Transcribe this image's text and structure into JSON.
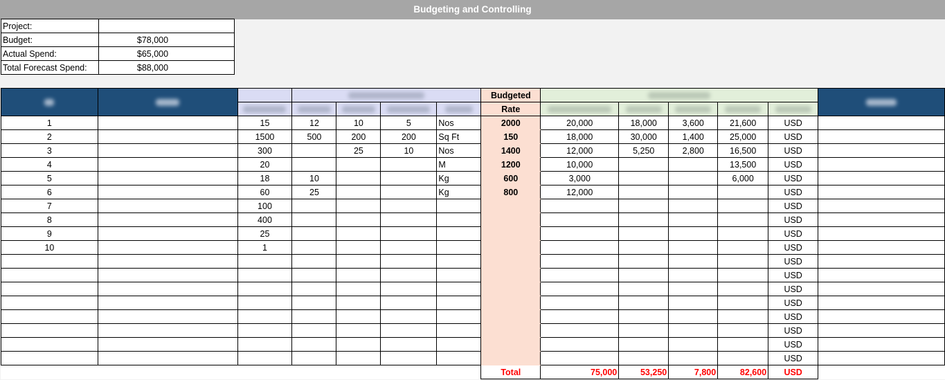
{
  "title": "Budgeting and Controlling",
  "summary": [
    {
      "label": "Project:",
      "value": ""
    },
    {
      "label": "Budget:",
      "value": "$78,000"
    },
    {
      "label": "Actual Spend:",
      "value": "$65,000"
    },
    {
      "label": "Total Forecast Spend:",
      "value": "$88,000"
    }
  ],
  "header": {
    "rate_line1": "Budgeted",
    "rate_line2": "Rate"
  },
  "rows": [
    {
      "n": "1",
      "q1": "15",
      "q2": "12",
      "q3": "10",
      "q4": "5",
      "unit": "Nos",
      "rate": "2000",
      "c1": "20,000",
      "c2": "18,000",
      "c3": "3,600",
      "c4": "21,600",
      "cur": "USD"
    },
    {
      "n": "2",
      "q1": "1500",
      "q2": "500",
      "q3": "200",
      "q4": "200",
      "unit": "Sq Ft",
      "rate": "150",
      "c1": "18,000",
      "c2": "30,000",
      "c3": "1,400",
      "c4": "25,000",
      "cur": "USD"
    },
    {
      "n": "3",
      "q1": "300",
      "q2": "",
      "q3": "25",
      "q4": "10",
      "unit": "Nos",
      "rate": "1400",
      "c1": "12,000",
      "c2": "5,250",
      "c3": "2,800",
      "c4": "16,500",
      "cur": "USD"
    },
    {
      "n": "4",
      "q1": "20",
      "q2": "",
      "q3": "",
      "q4": "",
      "unit": "M",
      "rate": "1200",
      "c1": "10,000",
      "c2": "",
      "c3": "",
      "c4": "13,500",
      "cur": "USD"
    },
    {
      "n": "5",
      "q1": "18",
      "q2": "10",
      "q3": "",
      "q4": "",
      "unit": "Kg",
      "rate": "600",
      "c1": "3,000",
      "c2": "",
      "c3": "",
      "c4": "6,000",
      "cur": "USD"
    },
    {
      "n": "6",
      "q1": "60",
      "q2": "25",
      "q3": "",
      "q4": "",
      "unit": "Kg",
      "rate": "800",
      "c1": "12,000",
      "c2": "",
      "c3": "",
      "c4": "",
      "cur": "USD"
    },
    {
      "n": "7",
      "q1": "100",
      "q2": "",
      "q3": "",
      "q4": "",
      "unit": "",
      "rate": "",
      "c1": "",
      "c2": "",
      "c3": "",
      "c4": "",
      "cur": "USD"
    },
    {
      "n": "8",
      "q1": "400",
      "q2": "",
      "q3": "",
      "q4": "",
      "unit": "",
      "rate": "",
      "c1": "",
      "c2": "",
      "c3": "",
      "c4": "",
      "cur": "USD"
    },
    {
      "n": "9",
      "q1": "25",
      "q2": "",
      "q3": "",
      "q4": "",
      "unit": "",
      "rate": "",
      "c1": "",
      "c2": "",
      "c3": "",
      "c4": "",
      "cur": "USD"
    },
    {
      "n": "10",
      "q1": "1",
      "q2": "",
      "q3": "",
      "q4": "",
      "unit": "",
      "rate": "",
      "c1": "",
      "c2": "",
      "c3": "",
      "c4": "",
      "cur": "USD"
    },
    {
      "n": "",
      "q1": "",
      "q2": "",
      "q3": "",
      "q4": "",
      "unit": "",
      "rate": "",
      "c1": "",
      "c2": "",
      "c3": "",
      "c4": "",
      "cur": "USD"
    },
    {
      "n": "",
      "q1": "",
      "q2": "",
      "q3": "",
      "q4": "",
      "unit": "",
      "rate": "",
      "c1": "",
      "c2": "",
      "c3": "",
      "c4": "",
      "cur": "USD"
    },
    {
      "n": "",
      "q1": "",
      "q2": "",
      "q3": "",
      "q4": "",
      "unit": "",
      "rate": "",
      "c1": "",
      "c2": "",
      "c3": "",
      "c4": "",
      "cur": "USD"
    },
    {
      "n": "",
      "q1": "",
      "q2": "",
      "q3": "",
      "q4": "",
      "unit": "",
      "rate": "",
      "c1": "",
      "c2": "",
      "c3": "",
      "c4": "",
      "cur": "USD"
    },
    {
      "n": "",
      "q1": "",
      "q2": "",
      "q3": "",
      "q4": "",
      "unit": "",
      "rate": "",
      "c1": "",
      "c2": "",
      "c3": "",
      "c4": "",
      "cur": "USD"
    },
    {
      "n": "",
      "q1": "",
      "q2": "",
      "q3": "",
      "q4": "",
      "unit": "",
      "rate": "",
      "c1": "",
      "c2": "",
      "c3": "",
      "c4": "",
      "cur": "USD"
    },
    {
      "n": "",
      "q1": "",
      "q2": "",
      "q3": "",
      "q4": "",
      "unit": "",
      "rate": "",
      "c1": "",
      "c2": "",
      "c3": "",
      "c4": "",
      "cur": "USD"
    },
    {
      "n": "",
      "q1": "",
      "q2": "",
      "q3": "",
      "q4": "",
      "unit": "",
      "rate": "",
      "c1": "",
      "c2": "",
      "c3": "",
      "c4": "",
      "cur": "USD"
    }
  ],
  "total": {
    "label": "Total",
    "c1": "75,000",
    "c2": "53,250",
    "c3": "7,800",
    "c4": "82,600",
    "cur": "USD"
  },
  "colors": {
    "titlebar": "#a6a6a6",
    "header_blue": "#1f4e79",
    "quantity_header": "#dadcf4",
    "cost_header": "#e2efda",
    "rate_column": "#fcdfd2",
    "total_text": "#ff0000"
  }
}
